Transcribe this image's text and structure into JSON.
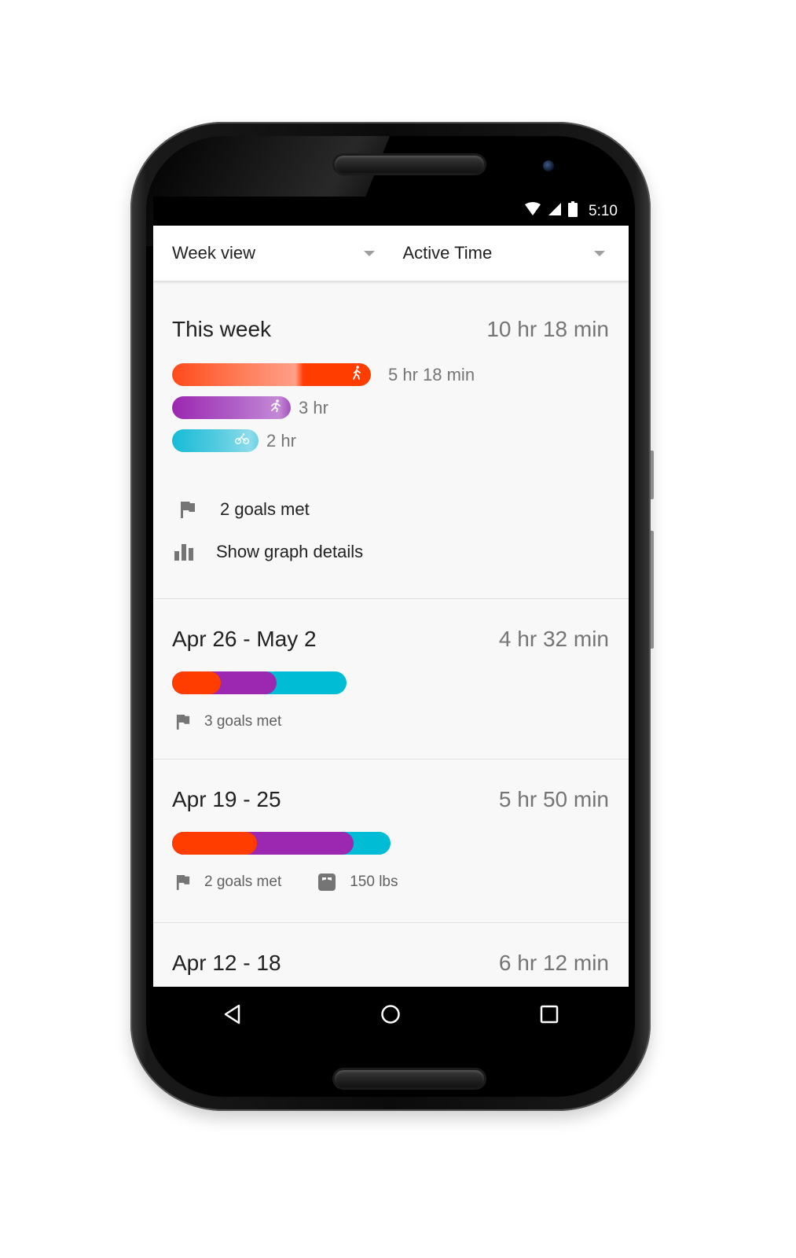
{
  "status_bar": {
    "time": "5:10",
    "icons": [
      "wifi-icon",
      "cell-signal-icon",
      "battery-icon"
    ]
  },
  "toolbar": {
    "view_dropdown": {
      "selected": "Week view"
    },
    "metric_dropdown": {
      "selected": "Active Time"
    }
  },
  "this_week": {
    "title": "This week",
    "total": "10 hr 18 min",
    "activities": [
      {
        "type": "walking",
        "icon": "walking-icon",
        "duration": "5 hr 18 min",
        "minutes": 318,
        "color": "#ff3d00"
      },
      {
        "type": "running",
        "icon": "running-icon",
        "duration": "3 hr",
        "minutes": 180,
        "color": "#9c27b0"
      },
      {
        "type": "biking",
        "icon": "bike-icon",
        "duration": "2 hr",
        "minutes": 120,
        "color": "#00bcd4"
      }
    ],
    "goals": "2 goals met",
    "graph_details": "Show graph details"
  },
  "weeks": [
    {
      "range": "Apr 26 - May 2",
      "total": "4 hr 32 min",
      "segments": [
        {
          "type": "walking",
          "fraction": 0.28,
          "color": "#ff3d00"
        },
        {
          "type": "running",
          "fraction": 0.32,
          "color": "#9c27b0"
        },
        {
          "type": "biking",
          "fraction": 0.4,
          "color": "#00bcd4"
        }
      ],
      "goals": "3 goals met",
      "weight": null
    },
    {
      "range": "Apr 19 - 25",
      "total": "5 hr 50 min",
      "segments": [
        {
          "type": "walking",
          "fraction": 0.39,
          "color": "#ff3d00"
        },
        {
          "type": "running",
          "fraction": 0.44,
          "color": "#9c27b0"
        },
        {
          "type": "biking",
          "fraction": 0.17,
          "color": "#00bcd4"
        }
      ],
      "goals": "2 goals met",
      "weight": "150 lbs"
    },
    {
      "range": "Apr 12 - 18",
      "total": "6 hr 12 min"
    }
  ],
  "nav_bar": {
    "buttons": [
      "back",
      "home",
      "recents"
    ]
  }
}
